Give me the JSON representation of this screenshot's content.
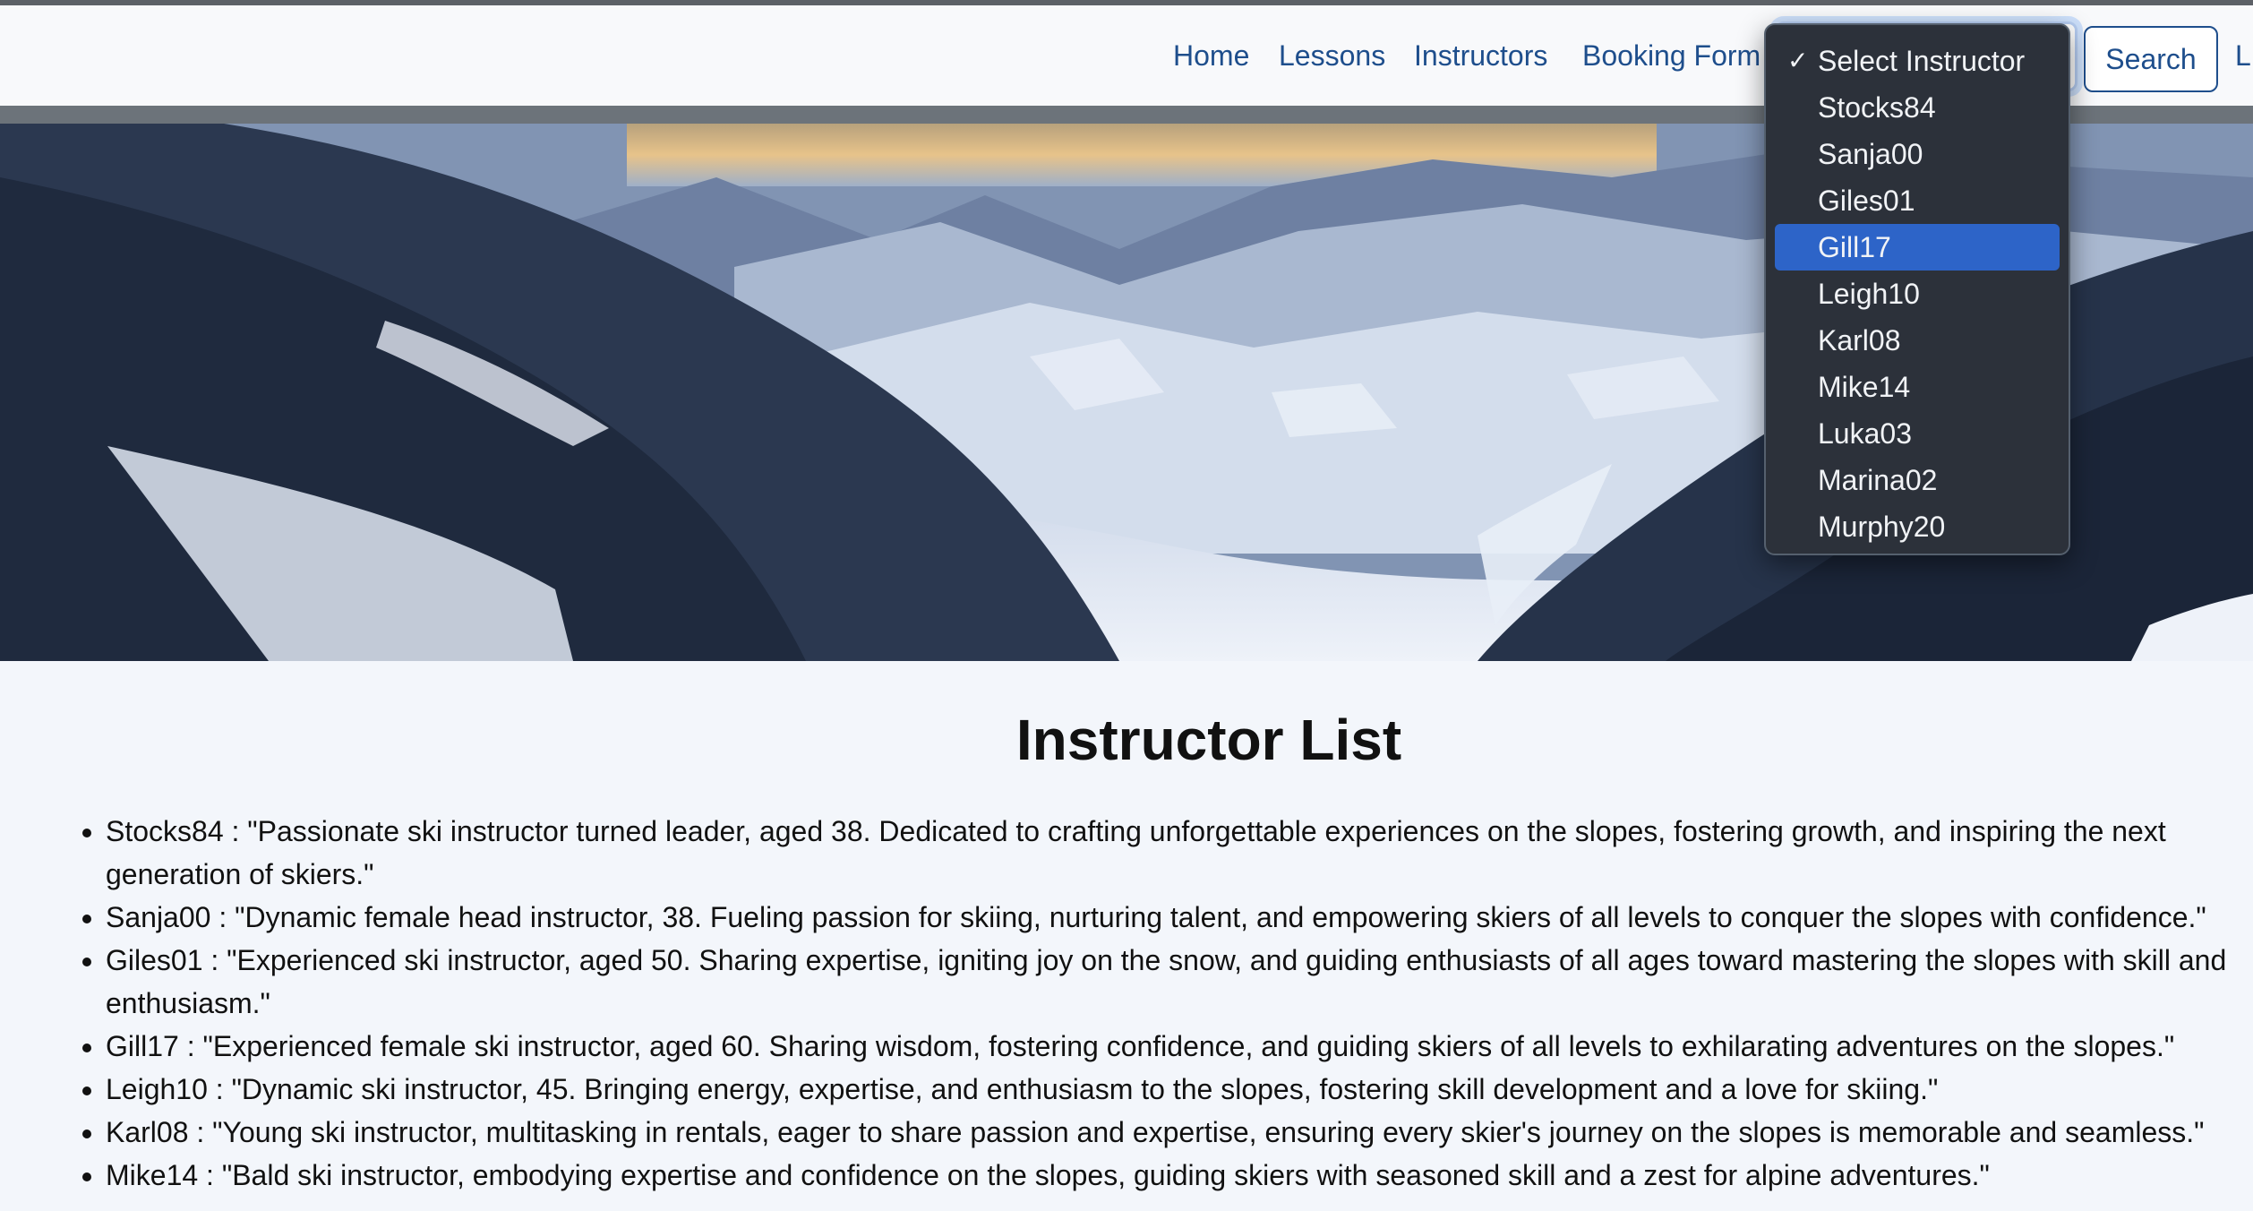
{
  "nav": {
    "links": [
      "Home",
      "Lessons",
      "Instructors",
      "Booking Form"
    ],
    "trailing_link": "L",
    "search_label": "Search"
  },
  "instructor_select": {
    "options": [
      "Select Instructor",
      "Stocks84",
      "Sanja00",
      "Giles01",
      "Gill17",
      "Leigh10",
      "Karl08",
      "Mike14",
      "Luka03",
      "Marina02",
      "Murphy20"
    ],
    "checked": "Select Instructor",
    "highlighted": "Gill17",
    "check_glyph": "✓"
  },
  "main": {
    "title": "Instructor List",
    "instructors": [
      "Stocks84 : \"Passionate ski instructor turned leader, aged 38. Dedicated to crafting unforgettable experiences on the slopes, fostering growth, and inspiring the next generation of skiers.\"",
      "Sanja00 : \"Dynamic female head instructor, 38. Fueling passion for skiing, nurturing talent, and empowering skiers of all levels to conquer the slopes with confidence.\"",
      "Giles01 : \"Experienced ski instructor, aged 50. Sharing expertise, igniting joy on the snow, and guiding enthusiasts of all ages toward mastering the slopes with skill and enthusiasm.\"",
      "Gill17 : \"Experienced female ski instructor, aged 60. Sharing wisdom, fostering confidence, and guiding skiers of all levels to exhilarating adventures on the slopes.\"",
      "Leigh10 : \"Dynamic ski instructor, 45. Bringing energy, expertise, and enthusiasm to the slopes, fostering skill development and a love for skiing.\"",
      "Karl08 : \"Young ski instructor, multitasking in rentals, eager to share passion and expertise, ensuring every skier's journey on the slopes is memorable and seamless.\"",
      "Mike14 : \"Bald ski instructor, embodying expertise and confidence on the slopes, guiding skiers with seasoned skill and a zest for alpine adventures.\""
    ]
  },
  "colors": {
    "nav_link": "#1e4e8c",
    "dropdown_bg": "#2c313a",
    "dropdown_highlight": "#2d64c8"
  }
}
